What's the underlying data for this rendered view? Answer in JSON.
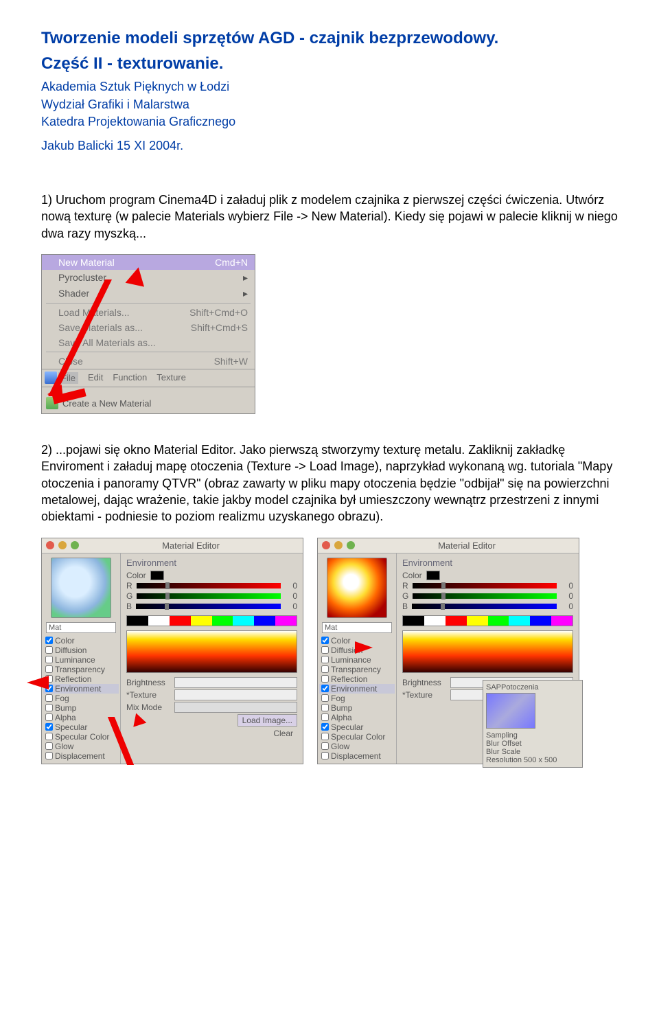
{
  "title_line1": "Tworzenie modeli sprzętów AGD - czajnik bezprzewodowy.",
  "title_line2": "Część II - texturowanie.",
  "header": {
    "l1": "Akademia Sztuk Pięknych w Łodzi",
    "l2": "Wydział Grafiki i Malarstwa",
    "l3": "Katedra Projektowania Graficznego",
    "l4": "Jakub Balicki 15 XI 2004r."
  },
  "para1": "1) Uruchom program Cinema4D i załaduj plik z modelem czajnika z pierwszej części ćwiczenia. Utwórz nową texturę (w palecie Materials wybierz File -> New Material). Kiedy się pojawi w palecie kliknij w niego dwa razy myszką...",
  "para2": "2) ...pojawi się okno Material Editor. Jako pierwszą stworzymy texturę metalu. Zakliknij zakładkę Enviroment i załaduj mapę otoczenia (Texture -> Load Image), naprzykład wykonaną wg. tutoriala \"Mapy otoczenia i panoramy QTVR\" (obraz zawarty w pliku mapy otoczenia będzie \"odbijał\" się na powierzchni metalowej, dając wrażenie, takie jakby model czajnika był umieszczony wewnątrz przestrzeni z innymi obiektami - podniesie to poziom realizmu uzyskanego obrazu).",
  "menu": {
    "new_material": "New Material",
    "new_material_sc": "Cmd+N",
    "pyrocluster": "Pyrocluster",
    "shader": "Shader",
    "load": "Load Materials...",
    "load_sc": "Shift+Cmd+O",
    "save_as": "Save Materials as...",
    "save_as_sc": "Shift+Cmd+S",
    "save_all": "Save All Materials as...",
    "close": "Close",
    "close_sc": "Shift+W",
    "bar_file": "File",
    "bar_edit": "Edit",
    "bar_function": "Function",
    "bar_texture": "Texture",
    "footer": "Create a New Material"
  },
  "editor": {
    "title": "Material Editor",
    "mat_name": "Mat",
    "channels": [
      "Color",
      "Diffusion",
      "Luminance",
      "Transparency",
      "Reflection",
      "Environment",
      "Fog",
      "Bump",
      "Alpha",
      "Specular",
      "Specular Color",
      "Glow",
      "Displacement"
    ],
    "env_title": "Environment",
    "color_label": "Color",
    "r": "R",
    "g": "G",
    "b": "B",
    "r_val": "0",
    "g_val": "0",
    "b_val": "0",
    "r_val2": "0",
    "g_val2": "0",
    "b_val2": "0",
    "brightness": "Brightness",
    "texture": "*Texture",
    "mix_mode": "Mix Mode",
    "load_image": "Load Image...",
    "clear": "Clear",
    "sub_title": "SAPPotoczenia",
    "sub_sampling": "Sampling",
    "sub_blur_offset": "Blur Offset",
    "sub_blur_scale": "Blur Scale",
    "sub_res": "Resolution 500 x 500"
  }
}
